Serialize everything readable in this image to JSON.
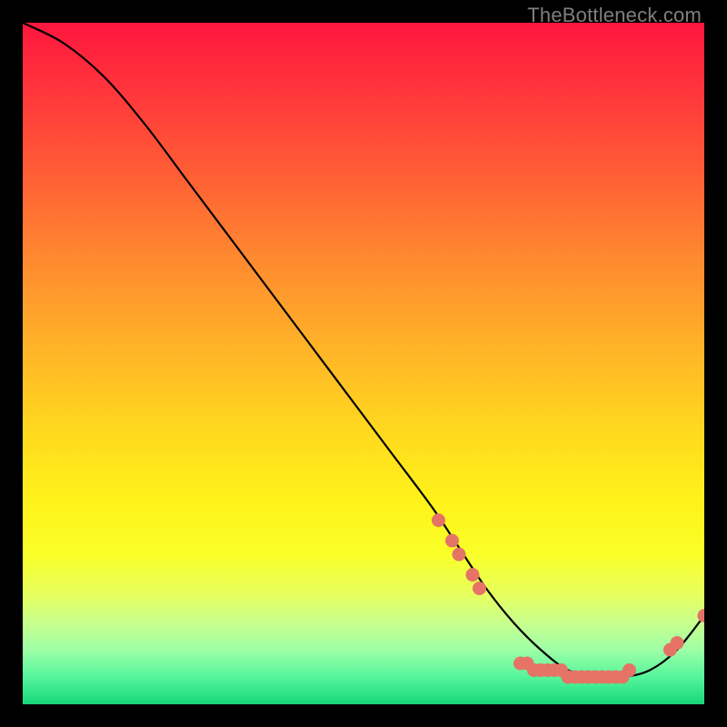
{
  "watermark": "TheBottleneck.com",
  "chart_data": {
    "type": "line",
    "title": "",
    "xlabel": "",
    "ylabel": "",
    "xlim": [
      0,
      100
    ],
    "ylim": [
      0,
      100
    ],
    "series": [
      {
        "name": "bottleneck-curve",
        "x": [
          0,
          6,
          12,
          18,
          24,
          30,
          36,
          42,
          48,
          54,
          60,
          64,
          68,
          72,
          76,
          80,
          84,
          88,
          92,
          96,
          100
        ],
        "y": [
          100,
          97,
          92,
          85,
          77,
          69,
          61,
          53,
          45,
          37,
          29,
          23,
          17,
          12,
          8,
          5,
          4,
          4,
          5,
          8,
          13
        ]
      }
    ],
    "markers": {
      "name": "highlighted-points",
      "color": "#e57366",
      "points": [
        {
          "x": 61,
          "y": 27
        },
        {
          "x": 63,
          "y": 24
        },
        {
          "x": 64,
          "y": 22
        },
        {
          "x": 66,
          "y": 19
        },
        {
          "x": 67,
          "y": 17
        },
        {
          "x": 73,
          "y": 6
        },
        {
          "x": 74,
          "y": 6
        },
        {
          "x": 75,
          "y": 5
        },
        {
          "x": 76,
          "y": 5
        },
        {
          "x": 77,
          "y": 5
        },
        {
          "x": 78,
          "y": 5
        },
        {
          "x": 79,
          "y": 5
        },
        {
          "x": 80,
          "y": 4
        },
        {
          "x": 81,
          "y": 4
        },
        {
          "x": 82,
          "y": 4
        },
        {
          "x": 83,
          "y": 4
        },
        {
          "x": 84,
          "y": 4
        },
        {
          "x": 85,
          "y": 4
        },
        {
          "x": 86,
          "y": 4
        },
        {
          "x": 87,
          "y": 4
        },
        {
          "x": 88,
          "y": 4
        },
        {
          "x": 89,
          "y": 5
        },
        {
          "x": 95,
          "y": 8
        },
        {
          "x": 96,
          "y": 9
        },
        {
          "x": 100,
          "y": 13
        }
      ]
    }
  }
}
